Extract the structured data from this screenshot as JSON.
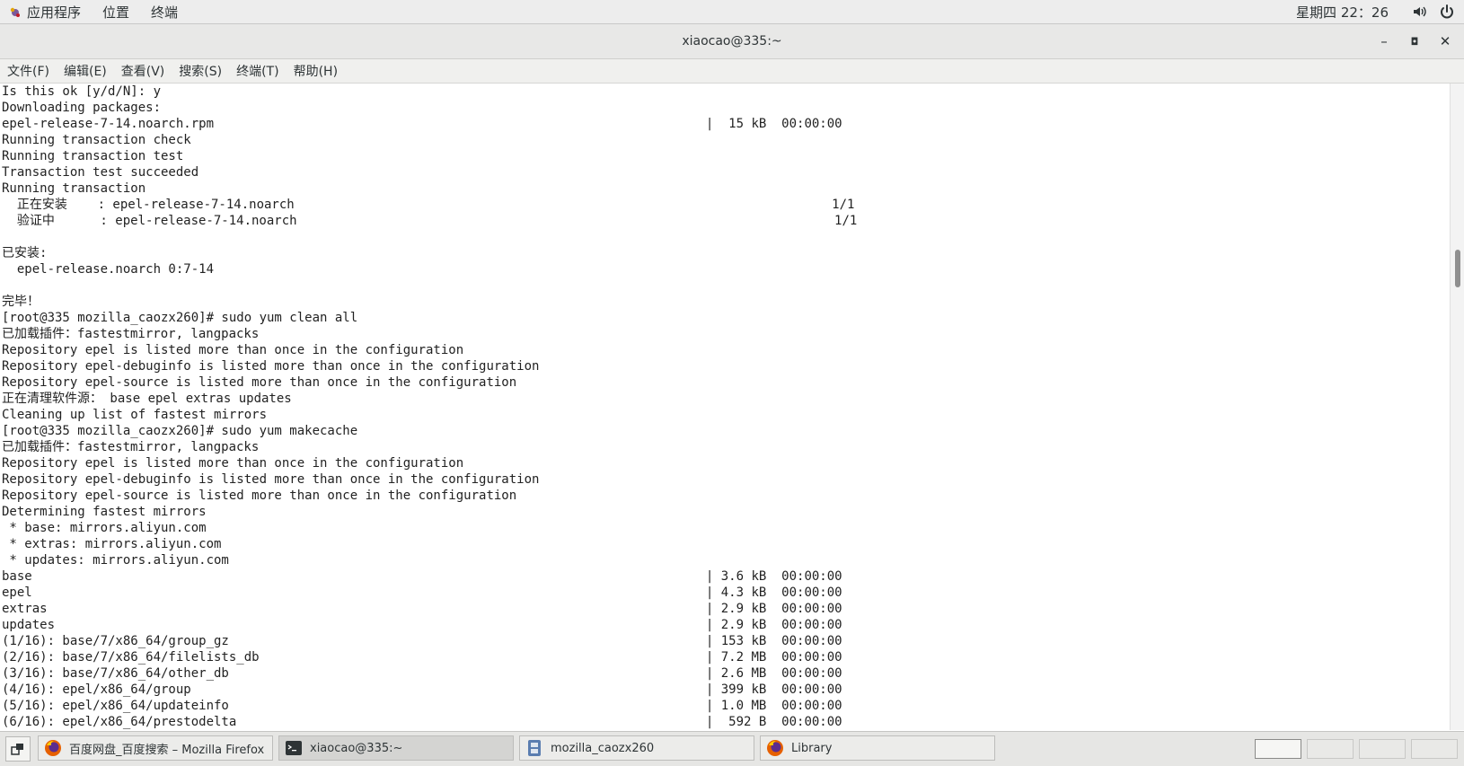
{
  "topbar": {
    "menus": [
      "应用程序",
      "位置",
      "终端"
    ],
    "clock": "星期四 22：26"
  },
  "window": {
    "title": "xiaocao@335:~"
  },
  "menubar": [
    "文件(F)",
    "编辑(E)",
    "查看(V)",
    "搜索(S)",
    "终端(T)",
    "帮助(H)"
  ],
  "terminal": {
    "lines": [
      "Is this ok [y/d/N]: y",
      "Downloading packages:",
      "epel-release-7-14.noarch.rpm                                                                 |  15 kB  00:00:00",
      "Running transaction check",
      "Running transaction test",
      "Transaction test succeeded",
      "Running transaction",
      "  正在安装    : epel-release-7-14.noarch                                                                       1/1",
      "  验证中      : epel-release-7-14.noarch                                                                       1/1",
      "",
      "已安装:",
      "  epel-release.noarch 0:7-14",
      "",
      "完毕！",
      "[root@335 mozilla_caozx260]# sudo yum clean all",
      "已加载插件：fastestmirror, langpacks",
      "Repository epel is listed more than once in the configuration",
      "Repository epel-debuginfo is listed more than once in the configuration",
      "Repository epel-source is listed more than once in the configuration",
      "正在清理软件源： base epel extras updates",
      "Cleaning up list of fastest mirrors",
      "[root@335 mozilla_caozx260]# sudo yum makecache",
      "已加载插件：fastestmirror, langpacks",
      "Repository epel is listed more than once in the configuration",
      "Repository epel-debuginfo is listed more than once in the configuration",
      "Repository epel-source is listed more than once in the configuration",
      "Determining fastest mirrors",
      " * base: mirrors.aliyun.com",
      " * extras: mirrors.aliyun.com",
      " * updates: mirrors.aliyun.com",
      "base                                                                                         | 3.6 kB  00:00:00",
      "epel                                                                                         | 4.3 kB  00:00:00",
      "extras                                                                                       | 2.9 kB  00:00:00",
      "updates                                                                                      | 2.9 kB  00:00:00",
      "(1/16): base/7/x86_64/group_gz                                                               | 153 kB  00:00:00",
      "(2/16): base/7/x86_64/filelists_db                                                           | 7.2 MB  00:00:00",
      "(3/16): base/7/x86_64/other_db                                                               | 2.6 MB  00:00:00",
      "(4/16): epel/x86_64/group                                                                    | 399 kB  00:00:00",
      "(5/16): epel/x86_64/updateinfo                                                               | 1.0 MB  00:00:00",
      "(6/16): epel/x86_64/prestodelta                                                              |  592 B  00:00:00"
    ]
  },
  "taskbar": {
    "items": [
      {
        "label": "百度网盘_百度搜索 – Mozilla Firefox",
        "icon": "firefox-icon"
      },
      {
        "label": "xiaocao@335:~",
        "icon": "terminal-icon"
      },
      {
        "label": "mozilla_caozx260",
        "icon": "file-manager-icon"
      },
      {
        "label": "Library",
        "icon": "firefox-icon"
      }
    ]
  },
  "colors": {
    "panel": "#ededed",
    "terminal_bg": "#ffffff",
    "terminal_fg": "#222222",
    "firefox_orange": "#e66000"
  }
}
